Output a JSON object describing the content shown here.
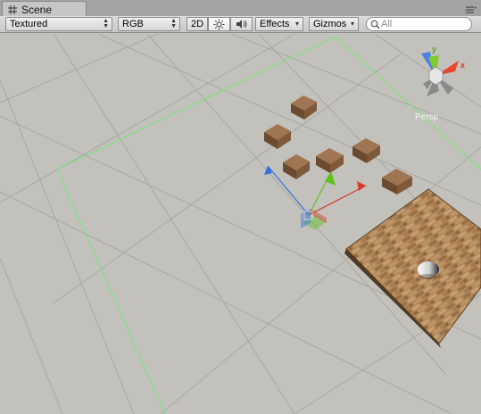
{
  "window": {
    "tab_title": "Scene",
    "tab_icon": "grid-icon",
    "menu_icon": "tab-menu-icon"
  },
  "toolbar": {
    "draw_mode": {
      "value": "Textured"
    },
    "render_mode": {
      "value": "RGB"
    },
    "toggle_2d": {
      "label": "2D",
      "active": false
    },
    "lighting": {
      "icon": "sun-icon",
      "active": true
    },
    "audio": {
      "icon": "speaker-icon",
      "active": false
    },
    "effects": {
      "label": "Effects"
    },
    "gizmos": {
      "label": "Gizmos"
    },
    "search": {
      "value": "",
      "placeholder": "All"
    }
  },
  "scene": {
    "orientation_gizmo": {
      "y_label": "y",
      "x_label": "x",
      "view_label": "Persp",
      "colors": {
        "x": "#e8452b",
        "y": "#7ccc2c",
        "z": "#3a6fd8"
      }
    },
    "camera_bounds_color": "#7de37d",
    "objects": [
      {
        "name": "crate-1"
      },
      {
        "name": "crate-2"
      },
      {
        "name": "crate-3"
      },
      {
        "name": "crate-4"
      },
      {
        "name": "crate-5"
      },
      {
        "name": "crate-6"
      },
      {
        "name": "brick-floor"
      },
      {
        "name": "ball"
      }
    ],
    "move_tool_colors": {
      "x": "#d8392a",
      "y": "#5ec21e",
      "z": "#3270e0"
    }
  }
}
